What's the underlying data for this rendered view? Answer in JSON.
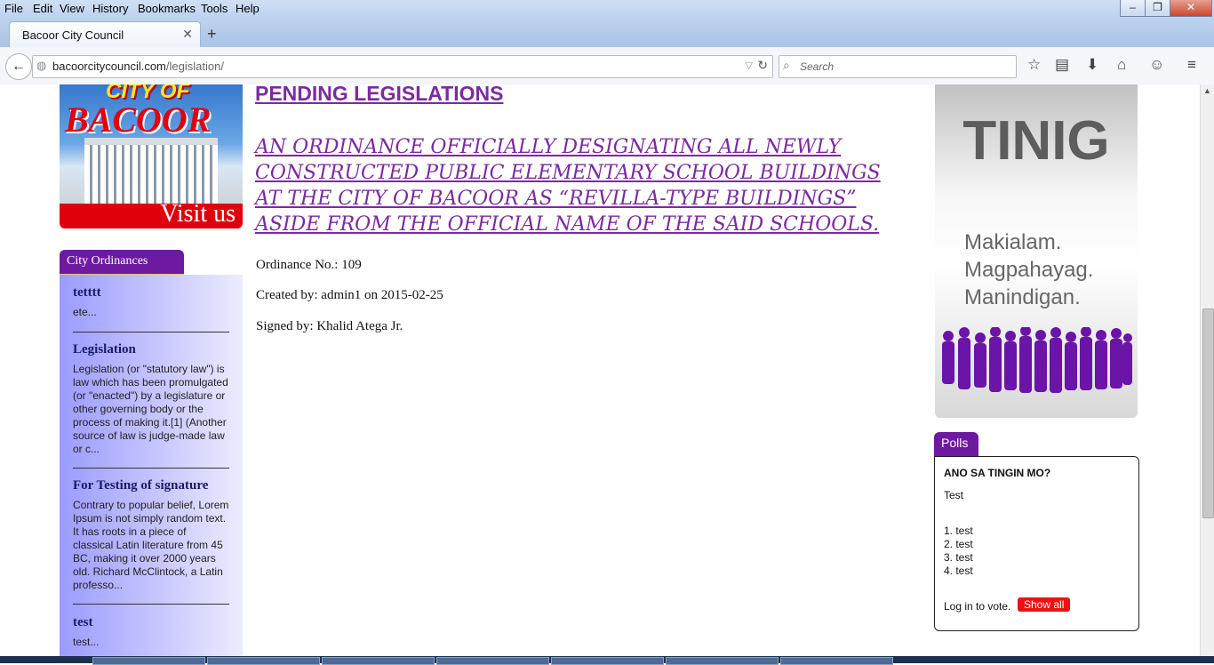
{
  "browser": {
    "menu": [
      "File",
      "Edit",
      "View",
      "History",
      "Bookmarks",
      "Tools",
      "Help"
    ],
    "tab_title": "Bacoor City Council",
    "url_domain": "bacoorcitycouncil.com",
    "url_path": "/legislation/",
    "search_placeholder": "Search"
  },
  "banner": {
    "line1": "CITY OF",
    "line2": "BACOOR",
    "cta": "Visit us"
  },
  "sidebar": {
    "tab_label": "City Ordinances",
    "items": [
      {
        "title": "tetttt",
        "text": "ete..."
      },
      {
        "title": "Legislation",
        "text": "Legislation (or \"statutory law\") is law which has been promulgated (or \"enacted\") by a legislature or other governing body or the process of making it.[1] (Another source of law is judge-made law or c..."
      },
      {
        "title": "For Testing of signature",
        "text": "Contrary to popular belief, Lorem Ipsum is not simply random text. It has roots in a piece of classical Latin literature from 45 BC, making it over 2000 years old. Richard McClintock, a Latin professo..."
      },
      {
        "title": "test",
        "text": "test..."
      }
    ]
  },
  "main": {
    "heading": "PENDING LEGISLATIONS",
    "ordinance_title": "AN ORDINANCE OFFICIALLY DESIGNATING ALL NEWLY CONSTRUCTED PUBLIC ELEMENTARY SCHOOL BUILDINGS AT THE CITY OF BACOOR AS “REVILLA-TYPE BUILDINGS” ASIDE FROM THE OFFICIAL NAME OF THE SAID SCHOOLS.",
    "ordinance_no": "Ordinance No.: 109",
    "created_by": "Created by: admin1 on 2015-02-25",
    "signed_by": "Signed by: Khalid Atega Jr."
  },
  "tinig": {
    "word": "TINIG",
    "slogan": [
      "Makialam.",
      "Magpahayag.",
      "Manindigan."
    ]
  },
  "polls": {
    "tab_label": "Polls",
    "question": "ANO SA TINGIN MO?",
    "subtitle": "Test",
    "options": [
      "1. test",
      "2. test",
      "3. test",
      "4. test"
    ],
    "login_text": "Log in to vote.",
    "show_all_label": "Show all"
  },
  "colors": {
    "accent_purple": "#7b2aa0",
    "tab_purple": "#6d1aa0",
    "button_red": "#e11111"
  }
}
